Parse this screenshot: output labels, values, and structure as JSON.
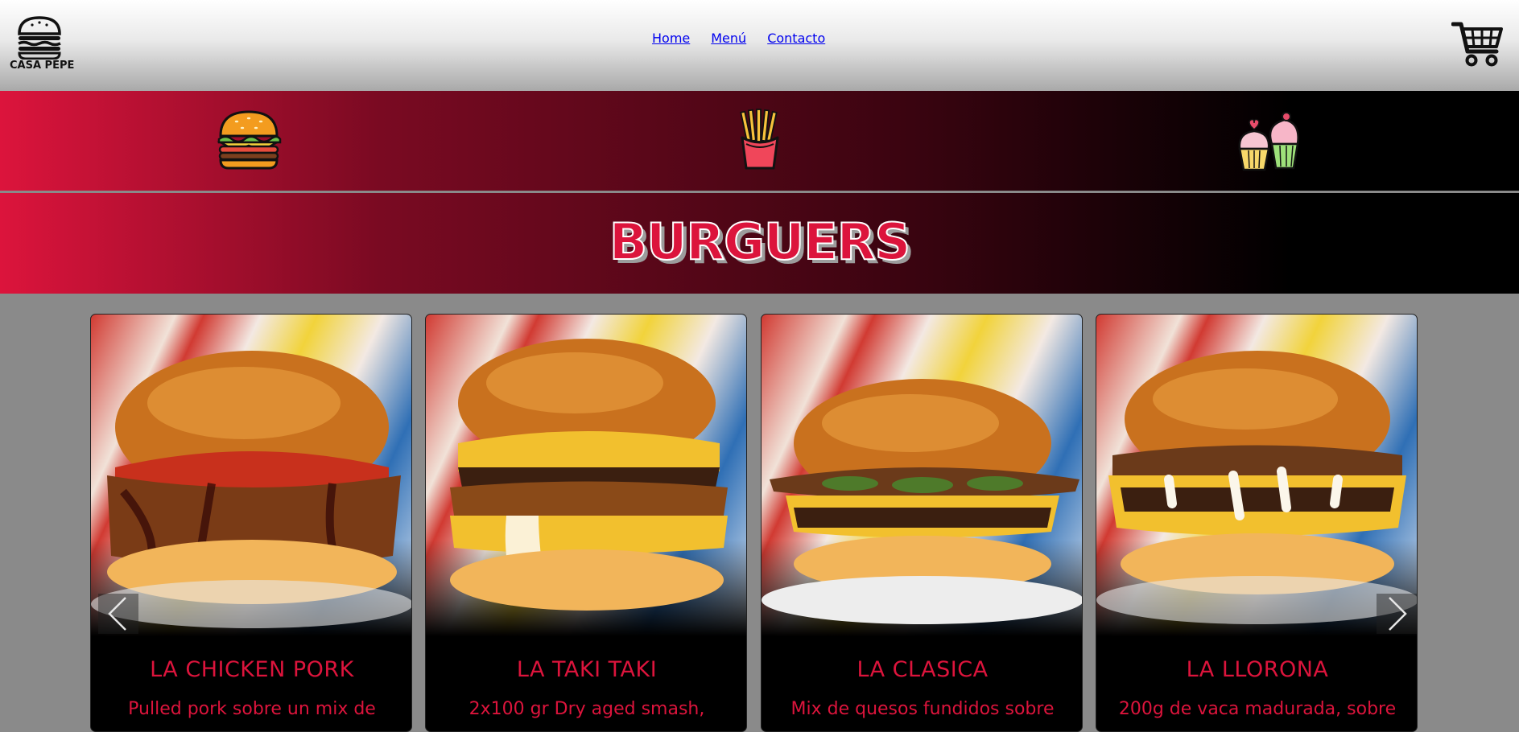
{
  "header": {
    "logo_text": "CASA PEPE",
    "nav": [
      {
        "label": "Home"
      },
      {
        "label": "Menú"
      },
      {
        "label": "Contacto"
      }
    ],
    "cart_icon": "shopping-cart-icon"
  },
  "categories": [
    {
      "icon": "burger-icon"
    },
    {
      "icon": "fries-icon"
    },
    {
      "icon": "cupcakes-icon"
    }
  ],
  "section": {
    "title": "BURGUERS"
  },
  "carousel": {
    "prev_icon": "chevron-left-icon",
    "next_icon": "chevron-right-icon",
    "cards": [
      {
        "title": "LA CHICKEN PORK",
        "desc": "Pulled pork sobre un mix de"
      },
      {
        "title": "LA TAKI TAKI",
        "desc": "2x100 gr Dry aged smash,"
      },
      {
        "title": "LA CLASICA",
        "desc": "Mix de quesos fundidos sobre"
      },
      {
        "title": "LA LLORONA",
        "desc": "200g de vaca madurada, sobre"
      }
    ]
  },
  "colors": {
    "accent": "#dc143c",
    "background": "#8a8a8a",
    "card": "#000000"
  }
}
